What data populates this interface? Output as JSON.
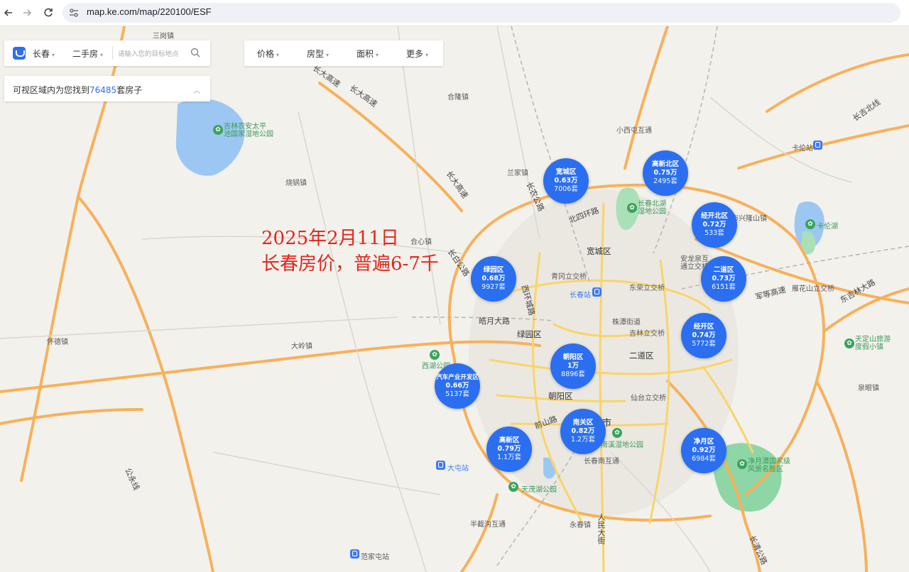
{
  "browser": {
    "back_icon": "arrow-left-icon",
    "forward_icon": "arrow-right-icon",
    "reload_icon": "reload-icon",
    "url": "map.ke.com/map/220100/ESF"
  },
  "search": {
    "city": "长春",
    "type": "二手房",
    "placeholder": "请输入您的目标地点"
  },
  "filters": {
    "price": "价格",
    "layout": "房型",
    "area": "面积",
    "more": "更多"
  },
  "result": {
    "prefix": "可视区域内为您找到",
    "count": "76485",
    "suffix": "套房子"
  },
  "annotation": {
    "line1": "2025年2月11日",
    "line2": "长春房价，普遍6-7千"
  },
  "districts": [
    {
      "name": "宽城区",
      "price": "0.63万",
      "count": "7006套"
    },
    {
      "name": "高新北区",
      "price": "0.75万",
      "count": "2495套"
    },
    {
      "name": "经开北区",
      "price": "0.72万",
      "count": "533套"
    },
    {
      "name": "二道区",
      "price": "0.73万",
      "count": "6151套"
    },
    {
      "name": "绿园区",
      "price": "0.68万",
      "count": "9927套"
    },
    {
      "name": "经开区",
      "price": "0.74万",
      "count": "5772套"
    },
    {
      "name": "朝阳区",
      "price": "1万",
      "count": "8896套"
    },
    {
      "name": "汽车产业开发区",
      "price": "0.66万",
      "count": "5137套"
    },
    {
      "name": "南关区",
      "price": "0.82万",
      "count": "1.2万套"
    },
    {
      "name": "高新区",
      "price": "0.79万",
      "count": "1.1万套"
    },
    {
      "name": "净月区",
      "price": "0.92万",
      "count": "6984套"
    }
  ],
  "map_labels": {
    "sanjia": "三岗镇",
    "changda1": "长大高速",
    "changda2": "长大高速",
    "hulong": "合隆镇",
    "jilin_park": "吉林农安太平\n池国家湿地公园",
    "xiaoxi": "小西屯互通",
    "lanjia": "兰家镇",
    "changda3": "长大高速",
    "changnong": "长农公路",
    "shaoguo": "烧锅镇",
    "kalun": "卡伦站",
    "changbei_park": "长春北湖\n湿地公园",
    "beisi": "北四环路",
    "xinglong": "市兴隆山镇",
    "kalun_lake": "卡伦湖",
    "hexin": "合心镇",
    "kuancheng": "宽城区",
    "anlong": "安龙泉互\n通立交桥",
    "changbai": "长白公路",
    "qinggang": "青冈立交桥",
    "dongrong": "东荣立交桥",
    "xihuan": "西环城路",
    "changchun_station": "长春站",
    "yulin": "雁花山立交桥",
    "changjilin": "长吉北线",
    "dongjilin": "东吉林大路",
    "jundao": "军等高速",
    "huaide": "怀德镇",
    "haoyue": "皓月大路",
    "luyuan": "绿园区",
    "zhutang": "株潭街道",
    "jilinli": "吉林立交桥",
    "dading": "大岭镇",
    "xihu_park": "西湖公园",
    "erdao": "二道区",
    "tianding": "天定山旅游\n度假小镇",
    "chaoyang": "朝阳区",
    "xiantai": "仙台立交桥",
    "quanyang": "泉眼镇",
    "shishi": "市",
    "jiangshan": "前山路",
    "changxi_park": "南溪湿地公园",
    "datun": "大屯站",
    "changnan": "长春南互通",
    "jingyue_park": "净月潭国家级\n风景名胜区",
    "tianmao": "天茂湖公园",
    "yongchun": "永春镇",
    "renmin": "人民大街",
    "banjie": "半截沟互通",
    "gongji": "公永线",
    "fanjiatun": "范家屯站",
    "changqing": "长清公路"
  }
}
